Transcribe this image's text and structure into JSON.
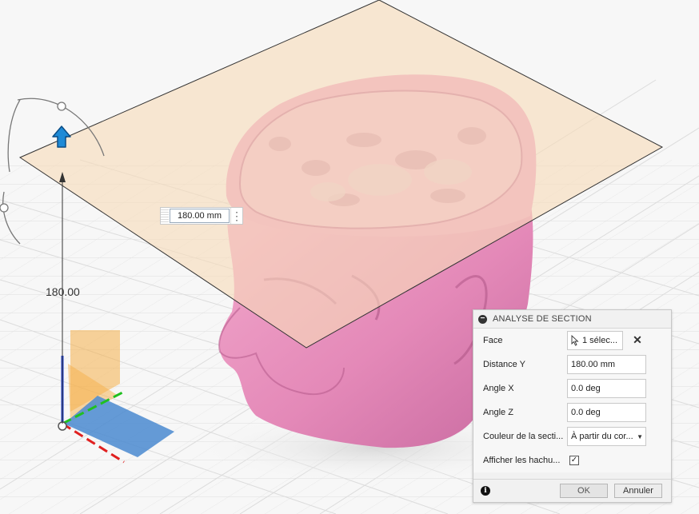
{
  "viewport": {
    "dimension_label": "180.00",
    "distance_input_value": "180.00 mm"
  },
  "panel": {
    "title": "ANALYSE DE SECTION",
    "rows": {
      "face": {
        "label": "Face",
        "value": "1 sélec..."
      },
      "distance_y": {
        "label": "Distance Y",
        "value": "180.00 mm"
      },
      "angle_x": {
        "label": "Angle X",
        "value": "0.0 deg"
      },
      "angle_z": {
        "label": "Angle Z",
        "value": "0.0 deg"
      },
      "section_color": {
        "label": "Couleur de la secti...",
        "value": "À partir du cor..."
      },
      "show_hatch": {
        "label": "Afficher les hachu...",
        "checked": true,
        "check_glyph": "✓"
      }
    },
    "footer": {
      "ok_label": "OK",
      "cancel_label": "Annuler"
    }
  },
  "colors": {
    "model_pink": "#e88fbf",
    "section_plane": "#f7dcb9",
    "accent_blue": "#1e8ad6",
    "axis_red": "#e02020",
    "axis_green": "#20c020"
  }
}
